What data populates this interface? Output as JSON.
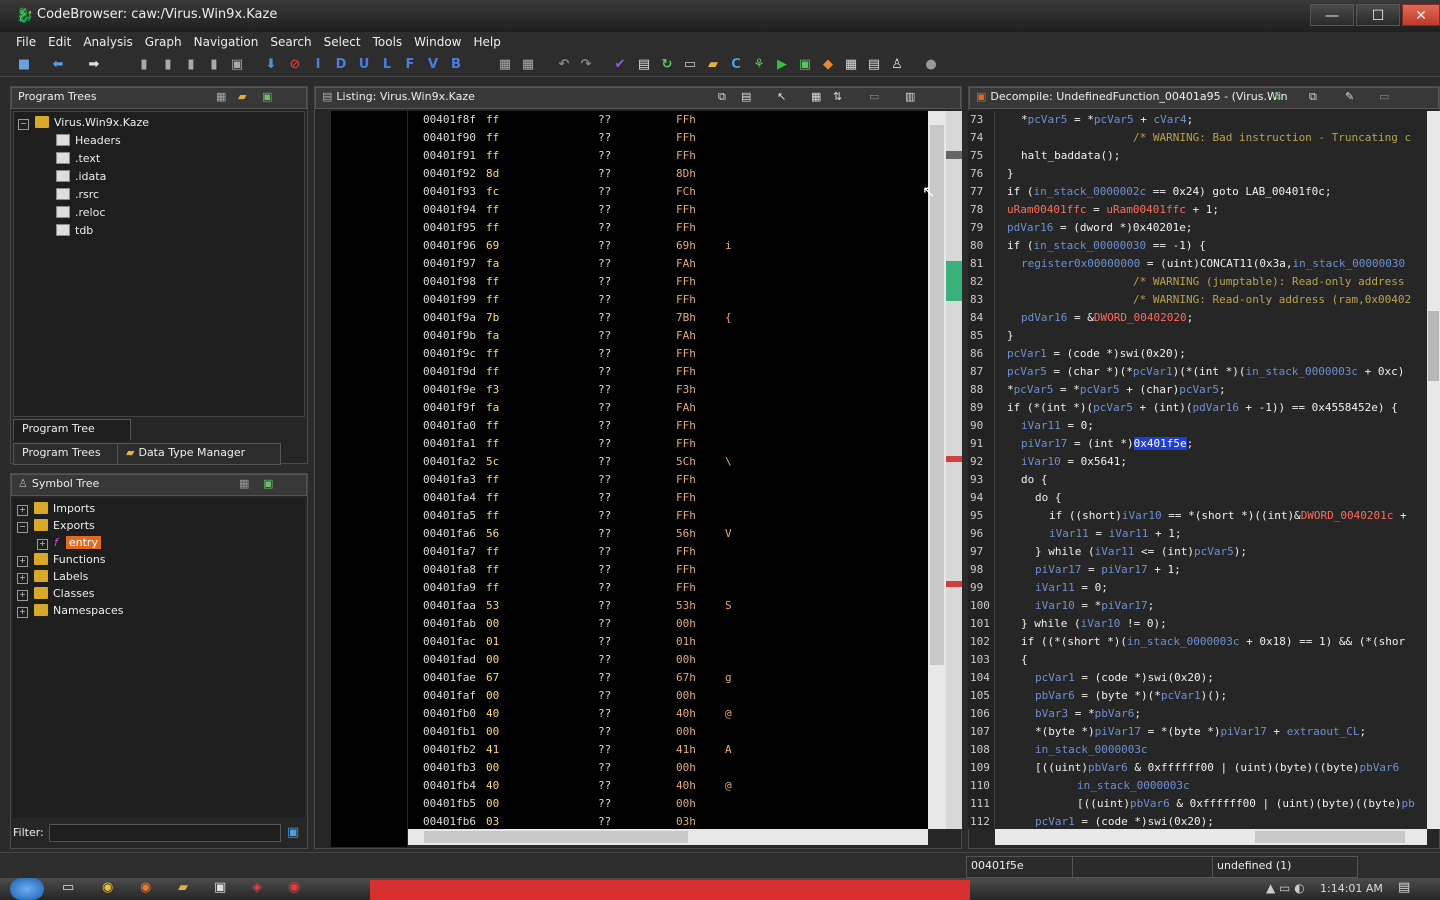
{
  "window": {
    "title": "CodeBrowser: caw:/Virus.Win9x.Kaze",
    "minimize": "—",
    "maximize": "☐",
    "close": "✕"
  },
  "menu": [
    "File",
    "Edit",
    "Analysis",
    "Graph",
    "Navigation",
    "Search",
    "Select",
    "Tools",
    "Window",
    "Help"
  ],
  "toolbar_letters": [
    "I",
    "D",
    "U",
    "L",
    "F",
    "V",
    "B"
  ],
  "program_trees": {
    "title": "Program Trees",
    "root": "Virus.Win9x.Kaze",
    "items": [
      "Headers",
      ".text",
      ".idata",
      ".rsrc",
      ".reloc",
      "tdb"
    ],
    "tab_active": "Program Tree",
    "bottom_tabs": [
      "Program Trees",
      "Data Type Manager"
    ]
  },
  "symbol_tree": {
    "title": "Symbol Tree",
    "items": [
      "Imports",
      "Exports",
      "entry",
      "Functions",
      "Labels",
      "Classes",
      "Namespaces"
    ],
    "filter_label": "Filter:",
    "filter_value": ""
  },
  "listing": {
    "title": "Listing:  Virus.Win9x.Kaze",
    "rows": [
      [
        "00401f8f",
        "ff",
        "??",
        "FFh",
        ""
      ],
      [
        "00401f90",
        "ff",
        "??",
        "FFh",
        ""
      ],
      [
        "00401f91",
        "ff",
        "??",
        "FFh",
        ""
      ],
      [
        "00401f92",
        "8d",
        "??",
        "8Dh",
        ""
      ],
      [
        "00401f93",
        "fc",
        "??",
        "FCh",
        ""
      ],
      [
        "00401f94",
        "ff",
        "??",
        "FFh",
        ""
      ],
      [
        "00401f95",
        "ff",
        "??",
        "FFh",
        ""
      ],
      [
        "00401f96",
        "69",
        "??",
        "69h",
        "i"
      ],
      [
        "00401f97",
        "fa",
        "??",
        "FAh",
        ""
      ],
      [
        "00401f98",
        "ff",
        "??",
        "FFh",
        ""
      ],
      [
        "00401f99",
        "ff",
        "??",
        "FFh",
        ""
      ],
      [
        "00401f9a",
        "7b",
        "??",
        "7Bh",
        "{"
      ],
      [
        "00401f9b",
        "fa",
        "??",
        "FAh",
        ""
      ],
      [
        "00401f9c",
        "ff",
        "??",
        "FFh",
        ""
      ],
      [
        "00401f9d",
        "ff",
        "??",
        "FFh",
        ""
      ],
      [
        "00401f9e",
        "f3",
        "??",
        "F3h",
        ""
      ],
      [
        "00401f9f",
        "fa",
        "??",
        "FAh",
        ""
      ],
      [
        "00401fa0",
        "ff",
        "??",
        "FFh",
        ""
      ],
      [
        "00401fa1",
        "ff",
        "??",
        "FFh",
        ""
      ],
      [
        "00401fa2",
        "5c",
        "??",
        "5Ch",
        "\\"
      ],
      [
        "00401fa3",
        "ff",
        "??",
        "FFh",
        ""
      ],
      [
        "00401fa4",
        "ff",
        "??",
        "FFh",
        ""
      ],
      [
        "00401fa5",
        "ff",
        "??",
        "FFh",
        ""
      ],
      [
        "00401fa6",
        "56",
        "??",
        "56h",
        "V"
      ],
      [
        "00401fa7",
        "ff",
        "??",
        "FFh",
        ""
      ],
      [
        "00401fa8",
        "ff",
        "??",
        "FFh",
        ""
      ],
      [
        "00401fa9",
        "ff",
        "??",
        "FFh",
        ""
      ],
      [
        "00401faa",
        "53",
        "??",
        "53h",
        "S"
      ],
      [
        "00401fab",
        "00",
        "??",
        "00h",
        ""
      ],
      [
        "00401fac",
        "01",
        "??",
        "01h",
        ""
      ],
      [
        "00401fad",
        "00",
        "??",
        "00h",
        ""
      ],
      [
        "00401fae",
        "67",
        "??",
        "67h",
        "g"
      ],
      [
        "00401faf",
        "00",
        "??",
        "00h",
        ""
      ],
      [
        "00401fb0",
        "40",
        "??",
        "40h",
        "@"
      ],
      [
        "00401fb1",
        "00",
        "??",
        "00h",
        ""
      ],
      [
        "00401fb2",
        "41",
        "??",
        "41h",
        "A"
      ],
      [
        "00401fb3",
        "00",
        "??",
        "00h",
        ""
      ],
      [
        "00401fb4",
        "40",
        "??",
        "40h",
        "@"
      ],
      [
        "00401fb5",
        "00",
        "??",
        "00h",
        ""
      ],
      [
        "00401fb6",
        "03",
        "??",
        "03h",
        ""
      ]
    ]
  },
  "decompile": {
    "title": "Decompile: UndefinedFunction_00401a95 - (Virus.Win",
    "lines": [
      {
        "n": "73",
        "indent": 1,
        "parts": [
          [
            "*",
            "kw"
          ],
          [
            "pcVar5",
            "var"
          ],
          [
            " = *",
            "kw"
          ],
          [
            "pcVar5",
            "var"
          ],
          [
            " + ",
            "kw"
          ],
          [
            "cVar4",
            "var"
          ],
          [
            ";",
            "kw"
          ]
        ]
      },
      {
        "n": "74",
        "indent": 9,
        "parts": [
          [
            "/* WARNING: Bad instruction - Truncating c",
            "cmt"
          ]
        ]
      },
      {
        "n": "75",
        "indent": 1,
        "parts": [
          [
            "halt_baddata();",
            "kw"
          ]
        ]
      },
      {
        "n": "76",
        "indent": 0,
        "parts": [
          [
            "}",
            "kw"
          ]
        ]
      },
      {
        "n": "77",
        "indent": 0,
        "parts": [
          [
            "if (",
            "kw"
          ],
          [
            "in_stack_0000002c",
            "var"
          ],
          [
            " == 0x24) goto LAB_00401f0c;",
            "kw"
          ]
        ]
      },
      {
        "n": "78",
        "indent": 0,
        "parts": [
          [
            "uRam00401ffc",
            "glob"
          ],
          [
            " = ",
            "kw"
          ],
          [
            "uRam00401ffc",
            "glob"
          ],
          [
            " + 1;",
            "kw"
          ]
        ]
      },
      {
        "n": "79",
        "indent": 0,
        "parts": [
          [
            "pdVar16",
            "var"
          ],
          [
            " = (dword *)0x40201e;",
            "kw"
          ]
        ]
      },
      {
        "n": "80",
        "indent": 0,
        "parts": [
          [
            "if (",
            "kw"
          ],
          [
            "in_stack_00000030",
            "var"
          ],
          [
            " == -1) {",
            "kw"
          ]
        ]
      },
      {
        "n": "81",
        "indent": 1,
        "parts": [
          [
            "register0x00000000",
            "var"
          ],
          [
            " = (uint)CONCAT11(0x3a,",
            "kw"
          ],
          [
            "in_stack_00000030",
            "var"
          ]
        ]
      },
      {
        "n": "82",
        "indent": 9,
        "parts": [
          [
            "/* WARNING (jumptable): Read-only address",
            "cmt"
          ]
        ]
      },
      {
        "n": "83",
        "indent": 9,
        "parts": [
          [
            "/* WARNING: Read-only address (ram,0x00402",
            "cmt"
          ]
        ]
      },
      {
        "n": "84",
        "indent": 1,
        "parts": [
          [
            "pdVar16",
            "var"
          ],
          [
            " = &",
            "kw"
          ],
          [
            "DWORD_00402020",
            "glob"
          ],
          [
            ";",
            "kw"
          ]
        ]
      },
      {
        "n": "85",
        "indent": 0,
        "parts": [
          [
            "}",
            "kw"
          ]
        ]
      },
      {
        "n": "86",
        "indent": 0,
        "parts": [
          [
            "pcVar1",
            "var"
          ],
          [
            " = (code *)swi(0x20);",
            "kw"
          ]
        ]
      },
      {
        "n": "87",
        "indent": 0,
        "parts": [
          [
            "pcVar5",
            "var"
          ],
          [
            " = (char *)(*",
            "kw"
          ],
          [
            "pcVar1",
            "var"
          ],
          [
            ")(*(int *)(",
            "kw"
          ],
          [
            "in_stack_0000003c",
            "var"
          ],
          [
            " + 0xc)",
            "kw"
          ]
        ]
      },
      {
        "n": "88",
        "indent": 0,
        "parts": [
          [
            "*",
            "kw"
          ],
          [
            "pcVar5",
            "var"
          ],
          [
            " = *",
            "kw"
          ],
          [
            "pcVar5",
            "var"
          ],
          [
            " + (char)",
            "kw"
          ],
          [
            "pcVar5",
            "var"
          ],
          [
            ";",
            "kw"
          ]
        ]
      },
      {
        "n": "89",
        "indent": 0,
        "parts": [
          [
            "if (*(int *)(",
            "kw"
          ],
          [
            "pcVar5",
            "var"
          ],
          [
            " + (int)(",
            "kw"
          ],
          [
            "pdVar16",
            "var"
          ],
          [
            " + -1)) == 0x4558452e) {",
            "kw"
          ]
        ]
      },
      {
        "n": "90",
        "indent": 1,
        "parts": [
          [
            "iVar11",
            "var"
          ],
          [
            " = 0;",
            "kw"
          ]
        ]
      },
      {
        "n": "91",
        "indent": 1,
        "parts": [
          [
            "piVar17",
            "var"
          ],
          [
            " = (int *)",
            "kw"
          ],
          [
            "0x401f5e",
            "hl"
          ],
          [
            ";",
            "kw"
          ]
        ]
      },
      {
        "n": "92",
        "indent": 1,
        "parts": [
          [
            "iVar10",
            "var"
          ],
          [
            " = 0x5641;",
            "kw"
          ]
        ]
      },
      {
        "n": "93",
        "indent": 1,
        "parts": [
          [
            "do {",
            "kw"
          ]
        ]
      },
      {
        "n": "94",
        "indent": 2,
        "parts": [
          [
            "do {",
            "kw"
          ]
        ]
      },
      {
        "n": "95",
        "indent": 3,
        "parts": [
          [
            "if ((short)",
            "kw"
          ],
          [
            "iVar10",
            "var"
          ],
          [
            " == *(short *)((int)&",
            "kw"
          ],
          [
            "DWORD_0040201c",
            "glob"
          ],
          [
            " +",
            "kw"
          ]
        ]
      },
      {
        "n": "96",
        "indent": 3,
        "parts": [
          [
            "iVar11",
            "var"
          ],
          [
            " = ",
            "kw"
          ],
          [
            "iVar11",
            "var"
          ],
          [
            " + 1;",
            "kw"
          ]
        ]
      },
      {
        "n": "97",
        "indent": 2,
        "parts": [
          [
            "} while (",
            "kw"
          ],
          [
            "iVar11",
            "var"
          ],
          [
            " <= (int)",
            "kw"
          ],
          [
            "pcVar5",
            "var"
          ],
          [
            ");",
            "kw"
          ]
        ]
      },
      {
        "n": "98",
        "indent": 2,
        "parts": [
          [
            "piVar17",
            "var"
          ],
          [
            " = ",
            "kw"
          ],
          [
            "piVar17",
            "var"
          ],
          [
            " + 1;",
            "kw"
          ]
        ]
      },
      {
        "n": "99",
        "indent": 2,
        "parts": [
          [
            "iVar11",
            "var"
          ],
          [
            " = 0;",
            "kw"
          ]
        ]
      },
      {
        "n": "100",
        "indent": 2,
        "parts": [
          [
            "iVar10",
            "var"
          ],
          [
            " = *",
            "kw"
          ],
          [
            "piVar17",
            "var"
          ],
          [
            ";",
            "kw"
          ]
        ]
      },
      {
        "n": "101",
        "indent": 1,
        "parts": [
          [
            "} while (",
            "kw"
          ],
          [
            "iVar10",
            "var"
          ],
          [
            " != 0);",
            "kw"
          ]
        ]
      },
      {
        "n": "102",
        "indent": 1,
        "parts": [
          [
            "if ((*(short *)(",
            "kw"
          ],
          [
            "in_stack_0000003c",
            "var"
          ],
          [
            " + 0x18) == 1) && (*(shor",
            "kw"
          ]
        ]
      },
      {
        "n": "103",
        "indent": 1,
        "parts": [
          [
            "{",
            "kw"
          ]
        ]
      },
      {
        "n": "104",
        "indent": 2,
        "parts": [
          [
            "pcVar1",
            "var"
          ],
          [
            " = (code *)swi(0x20);",
            "kw"
          ]
        ]
      },
      {
        "n": "105",
        "indent": 2,
        "parts": [
          [
            "pbVar6",
            "var"
          ],
          [
            " = (byte *)(*",
            "kw"
          ],
          [
            "pcVar1",
            "var"
          ],
          [
            ")();",
            "kw"
          ]
        ]
      },
      {
        "n": "106",
        "indent": 2,
        "parts": [
          [
            "bVar3",
            "var"
          ],
          [
            " = *",
            "kw"
          ],
          [
            "pbVar6",
            "var"
          ],
          [
            ";",
            "kw"
          ]
        ]
      },
      {
        "n": "107",
        "indent": 2,
        "parts": [
          [
            "*(byte *)",
            "kw"
          ],
          [
            "piVar17",
            "var"
          ],
          [
            " = *(byte *)",
            "kw"
          ],
          [
            "piVar17",
            "var"
          ],
          [
            " + ",
            "kw"
          ],
          [
            "extraout_CL",
            "var"
          ],
          [
            ";",
            "kw"
          ]
        ]
      },
      {
        "n": "108",
        "indent": 2,
        "parts": [
          [
            "in_stack_0000003c",
            "var"
          ]
        ]
      },
      {
        "n": "109",
        "indent": 2,
        "parts": [
          [
            "[((uint)",
            "kw"
          ],
          [
            "pbVar6",
            "var"
          ],
          [
            " & 0xffffff00 | (uint)(byte)((byte)",
            "kw"
          ],
          [
            "pbVar6",
            "var"
          ]
        ]
      },
      {
        "n": "110",
        "indent": 5,
        "parts": [
          [
            "in_stack_0000003c",
            "var"
          ]
        ]
      },
      {
        "n": "111",
        "indent": 5,
        "parts": [
          [
            "[((uint)",
            "kw"
          ],
          [
            "pbVar6",
            "var"
          ],
          [
            " & 0xffffff00 | (uint)(byte)((byte)",
            "kw"
          ],
          [
            "pb",
            "var"
          ]
        ]
      },
      {
        "n": "112",
        "indent": 2,
        "parts": [
          [
            "pcVar1",
            "var"
          ],
          [
            " = (code *)swi(0x20);",
            "kw"
          ]
        ]
      }
    ]
  },
  "status": {
    "address": "00401f5e",
    "middle": "",
    "type": "undefined  (1)"
  },
  "taskbar": {
    "time": "1:14:01 AM"
  },
  "colors": {
    "highlight": "#1e3ed8",
    "variable": "#6f8fd0",
    "comment": "#b8a34f",
    "global": "#ff6b5a"
  }
}
